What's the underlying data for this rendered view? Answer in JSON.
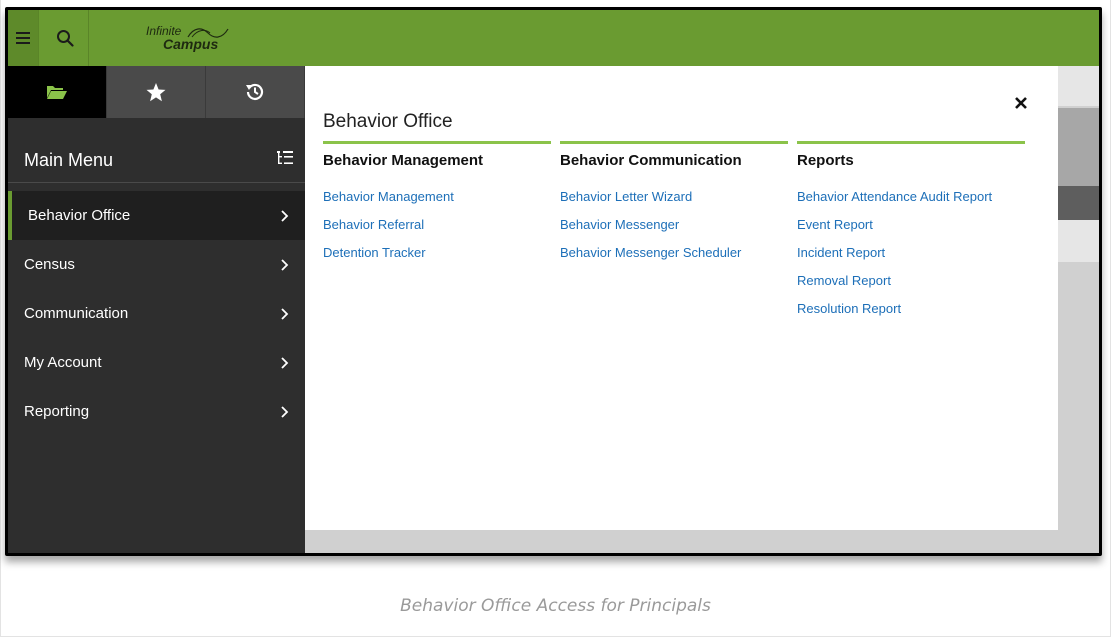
{
  "app": {
    "logo_line1": "Infinite",
    "logo_line2": "Campus",
    "brand_color": "#6a9b31",
    "accent_color": "#8bc34a"
  },
  "topbar": {
    "menu_icon": "hamburger-menu-icon",
    "search_icon": "search-icon"
  },
  "sidebar": {
    "tabs": [
      {
        "icon": "folder-open-icon",
        "active": true
      },
      {
        "icon": "star-icon",
        "active": false
      },
      {
        "icon": "history-icon",
        "active": false
      }
    ],
    "title": "Main Menu",
    "title_icon": "list-hierarchy-icon",
    "items": [
      {
        "label": "Behavior Office",
        "selected": true
      },
      {
        "label": "Census",
        "selected": false
      },
      {
        "label": "Communication",
        "selected": false
      },
      {
        "label": "My Account",
        "selected": false
      },
      {
        "label": "Reporting",
        "selected": false
      }
    ]
  },
  "panel": {
    "title": "Behavior Office",
    "close_icon": "close-icon",
    "columns": [
      {
        "heading": "Behavior Management",
        "links": [
          "Behavior Management",
          "Behavior Referral",
          "Detention Tracker"
        ]
      },
      {
        "heading": "Behavior Communication",
        "links": [
          "Behavior Letter Wizard",
          "Behavior Messenger",
          "Behavior Messenger Scheduler"
        ]
      },
      {
        "heading": "Reports",
        "links": [
          "Behavior Attendance Audit Report",
          "Event Report",
          "Incident Report",
          "Removal Report",
          "Resolution Report"
        ]
      }
    ]
  },
  "caption": "Behavior Office Access for Principals"
}
